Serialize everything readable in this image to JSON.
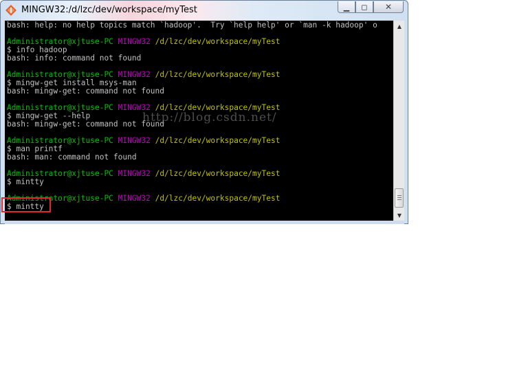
{
  "window": {
    "title": "MINGW32:/d/lzc/dev/workspace/myTest",
    "minimize_label": "▁",
    "maximize_label": "◻",
    "close_label": "✕"
  },
  "terminal": {
    "help_line": "bash: help: no help topics match `hadoop'.  Try `help help' or `man -k hadoop' o",
    "prompt_user": "Administrator@xjtuse-PC",
    "prompt_host": "MINGW32",
    "prompt_path": "/d/lzc/dev/workspace/myTest",
    "cmd1": "$ info hadoop",
    "out1": "bash: info: command not found",
    "cmd2": "$ mingw-get install msys-man",
    "out2": "bash: mingw-get: command not found",
    "cmd3": "$ mingw-get --help",
    "out3": "bash: mingw-get: command not found",
    "cmd4": "$ man printf",
    "out4": "bash: man: command not found",
    "cmd5": "$ mintty",
    "cmd6": "$ mintty"
  },
  "watermark": "http://blog.csdn.net/",
  "colors": {
    "terminal_bg": "#000000",
    "text": "#c0c0c0",
    "user": "#00c000",
    "host": "#c000c0",
    "path": "#c0c000",
    "highlight": "#e0292d"
  },
  "icons": [
    "app-icon",
    "minimize-icon",
    "maximize-icon",
    "close-icon",
    "scroll-up-icon",
    "scroll-down-icon"
  ]
}
